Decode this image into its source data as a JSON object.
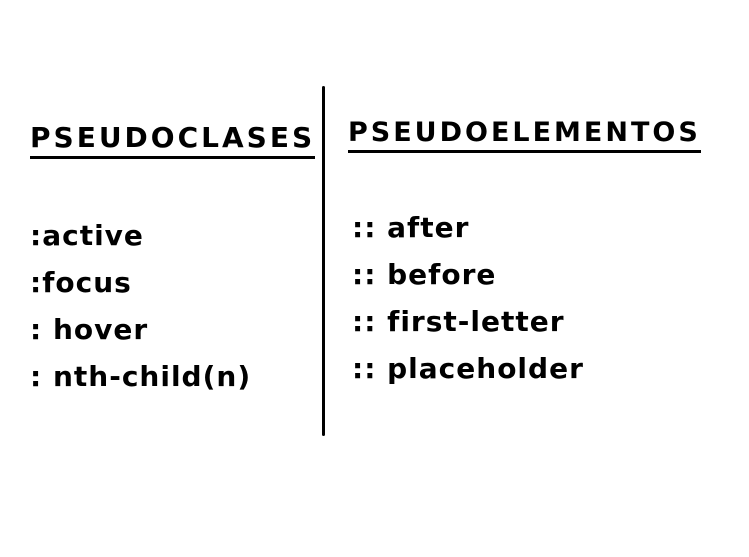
{
  "pseudoclases": {
    "title": "PSEUDOCLASES",
    "items": [
      ":active",
      ":focus",
      ": hover",
      ": nth-child(n)"
    ]
  },
  "pseudoelementos": {
    "title": "PSEUDOELEMENTOS",
    "items": [
      ":: after",
      ":: before",
      ":: first-letter",
      ":: placeholder"
    ]
  }
}
